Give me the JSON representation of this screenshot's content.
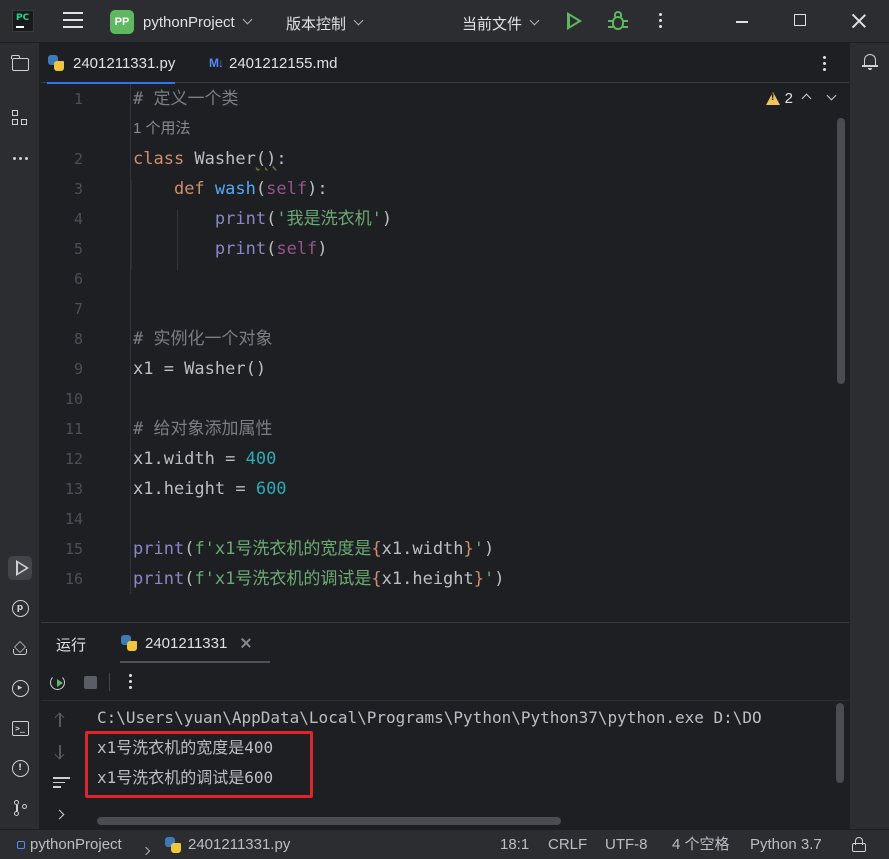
{
  "titlebar": {
    "logo_text": "PC",
    "project_badge": "PP",
    "project_name": "pythonProject",
    "vcs_label": "版本控制",
    "run_config": "当前文件"
  },
  "tabs": [
    {
      "label": "2401211331.py",
      "icon": "python-file-icon",
      "active": true
    },
    {
      "label": "2401212155.md",
      "icon": "markdown-file-icon",
      "icon_text": "M↓",
      "active": false
    }
  ],
  "editor": {
    "warning_count": "2",
    "usage_hint": "1 个用法",
    "line_numbers": [
      "1",
      "2",
      "3",
      "4",
      "5",
      "6",
      "7",
      "8",
      "9",
      "10",
      "11",
      "12",
      "13",
      "14",
      "15",
      "16"
    ]
  },
  "run_panel": {
    "label": "运行",
    "tab_label": "2401211331",
    "console_lines": [
      "C:\\Users\\yuan\\AppData\\Local\\Programs\\Python\\Python37\\python.exe D:\\DO",
      "x1号洗衣机的宽度是400",
      "x1号洗衣机的调试是600"
    ]
  },
  "statusbar": {
    "project": "pythonProject",
    "file": "2401211331.py",
    "position": "18:1",
    "line_separator": "CRLF",
    "encoding": "UTF-8",
    "indent": "4 个空格",
    "interpreter": "Python 3.7"
  },
  "colors": {
    "background": "#1e1f22",
    "panel": "#2b2d30",
    "accent": "#3574f0",
    "run_green": "#5fb85f",
    "highlight_red": "#e0242e"
  }
}
